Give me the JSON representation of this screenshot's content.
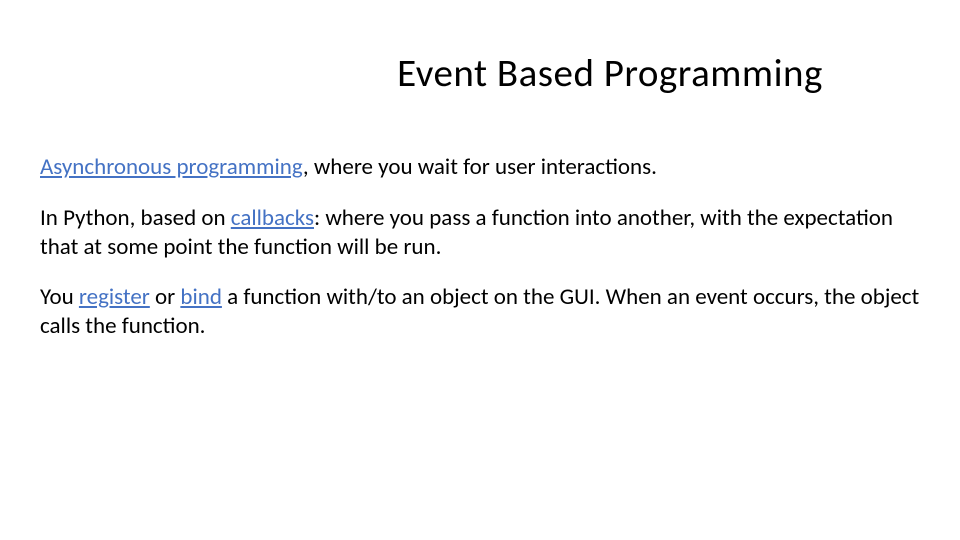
{
  "slide": {
    "title": "Event Based Programming",
    "para1": {
      "link": "Asynchronous programming",
      "rest": ", where you wait for user interactions."
    },
    "para2": {
      "before": "In Python, based on ",
      "link": "callbacks",
      "after": ": where you pass a function into another, with the expectation that at some point the function will be run."
    },
    "para3": {
      "before": "You ",
      "link1": "register",
      "mid": " or ",
      "link2": "bind",
      "after": " a function with/to an object on the GUI. When an event occurs, the object calls the function."
    }
  }
}
